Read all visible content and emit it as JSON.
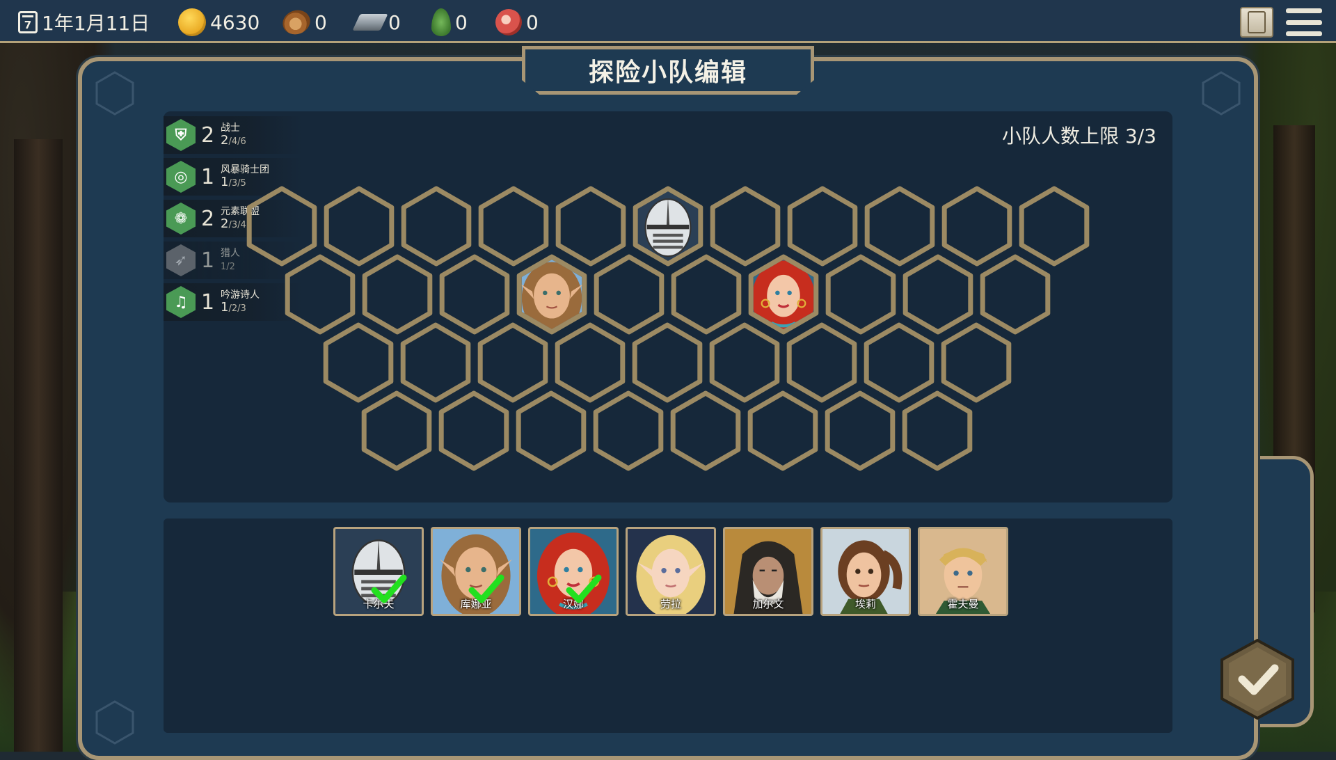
{
  "topbar": {
    "calendar_day_glyph": "7",
    "date": "1年1月11日",
    "gold": "4630",
    "wood": "0",
    "iron": "0",
    "herb": "0",
    "meat": "0"
  },
  "panel": {
    "title": "探险小队编辑",
    "capacity": "小队人数上限 3/3"
  },
  "synergies": [
    {
      "icon": "warrior-armor-icon",
      "color": "#4a9a55",
      "glyph": "⛨",
      "count": "2",
      "name": "战士",
      "current": "2",
      "rest": "/4/6",
      "active": true
    },
    {
      "icon": "storm-spiral-icon",
      "color": "#4a9a55",
      "glyph": "◎",
      "count": "1",
      "name": "风暴骑士团",
      "current": "1",
      "rest": "/3/5",
      "active": true
    },
    {
      "icon": "element-swirl-icon",
      "color": "#4a9a55",
      "glyph": "❁",
      "count": "2",
      "name": "元素联盟",
      "current": "2",
      "rest": "/3/4",
      "active": true
    },
    {
      "icon": "hunter-bow-icon",
      "color": "#8a8a8a",
      "glyph": "➶",
      "count": "1",
      "name": "猎人",
      "current": "",
      "rest": "1/2",
      "active": false
    },
    {
      "icon": "music-note-icon",
      "color": "#4a9a55",
      "glyph": "♫",
      "count": "1",
      "name": "吟游诗人",
      "current": "1",
      "rest": "/2/3",
      "active": true
    }
  ],
  "board": {
    "placed": [
      {
        "row": 0,
        "col": 5,
        "hero": "卡尔夫"
      },
      {
        "row": 1,
        "col": 3,
        "hero": "库娜亚"
      },
      {
        "row": 1,
        "col": 6,
        "hero": "汉娜"
      }
    ]
  },
  "roster": [
    {
      "name": "卡尔夫",
      "portrait": "knight-helmet",
      "selected": true,
      "bg": "#2b3f55"
    },
    {
      "name": "库娜亚",
      "portrait": "elf-woman-brown",
      "selected": true,
      "bg": "#7fb0d8"
    },
    {
      "name": "汉娜",
      "portrait": "red-haired-woman",
      "selected": true,
      "bg": "#2e6a8a"
    },
    {
      "name": "劳拉",
      "portrait": "blonde-elf",
      "selected": false,
      "bg": "#24324c"
    },
    {
      "name": "加尔文",
      "portrait": "hooded-old-man",
      "selected": false,
      "bg": "#b98a3c"
    },
    {
      "name": "埃莉",
      "portrait": "brown-ponytail-woman",
      "selected": false,
      "bg": "#c9d6de"
    },
    {
      "name": "霍夫曼",
      "portrait": "blonde-man",
      "selected": false,
      "bg": "#d9b88e"
    }
  ],
  "colors": {
    "panel_bg": "#1e3a52",
    "board_bg": "#16283a",
    "frame": "#a89675",
    "hex_stroke": "#9c8a63",
    "check": "#22e01f"
  }
}
